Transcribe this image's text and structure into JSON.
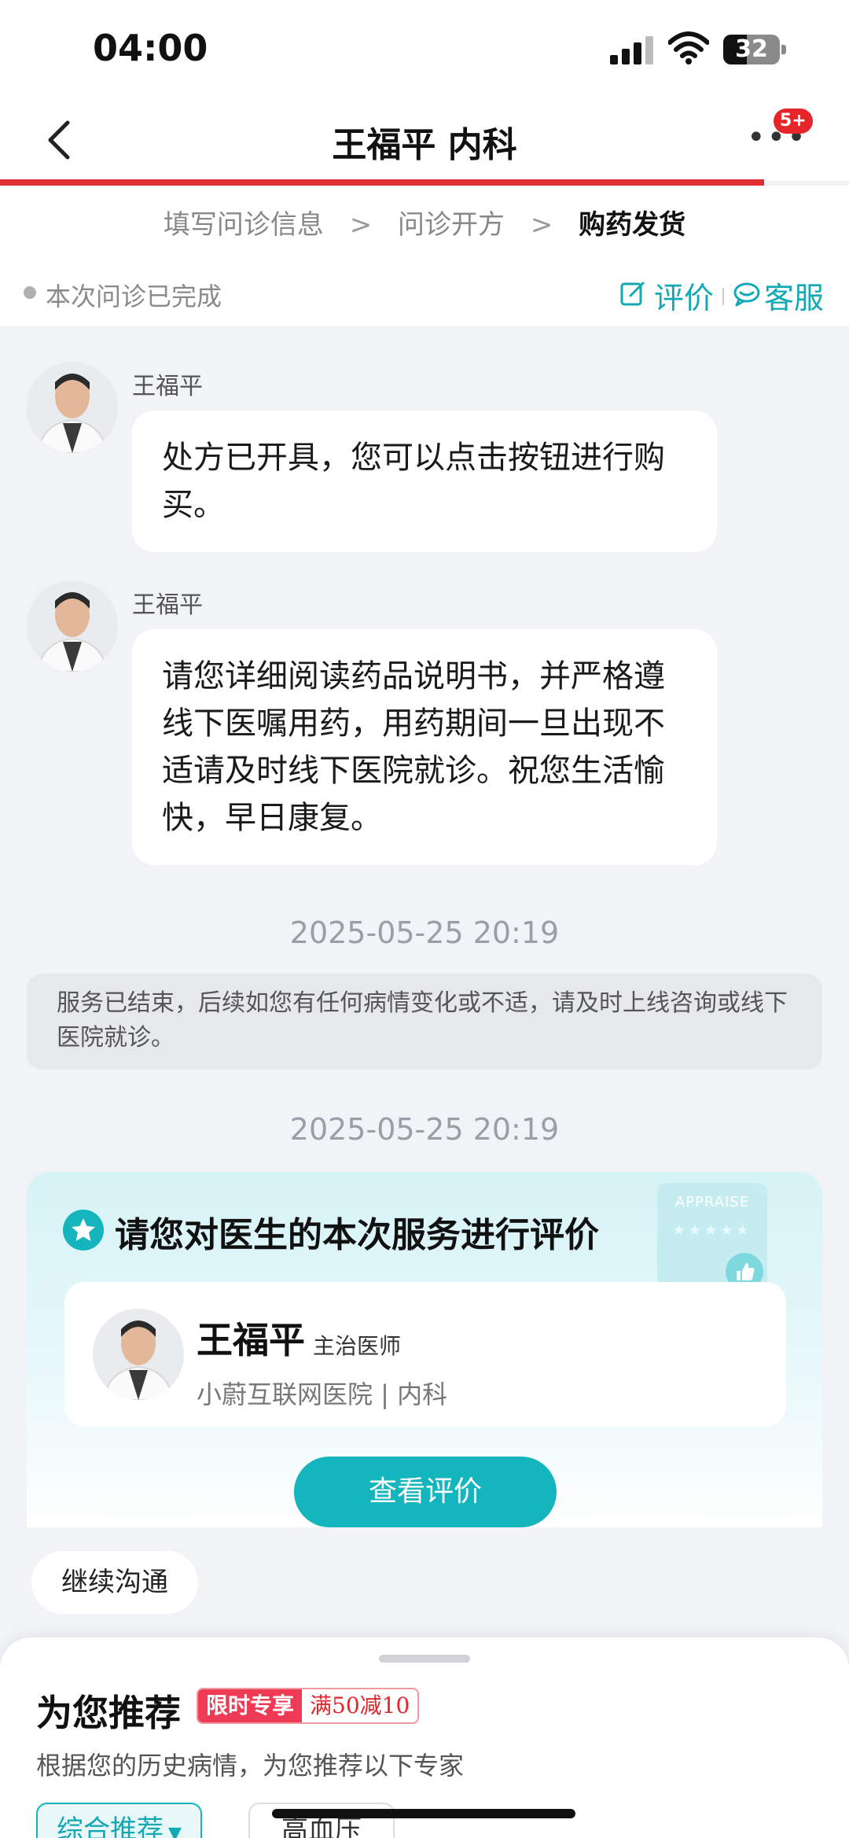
{
  "status_bar": {
    "time": "04:00",
    "battery": "32"
  },
  "nav": {
    "title": "王福平 内科",
    "badge": "5+"
  },
  "steps": [
    "填写问诊信息",
    "问诊开方",
    "购药发货"
  ],
  "step_separator": ">",
  "consult": {
    "status": "本次问诊已完成",
    "evaluate": "评价",
    "service": "客服"
  },
  "messages": [
    {
      "sender": "王福平",
      "text": "处方已开具，您可以点击按钮进行购买。"
    },
    {
      "sender": "王福平",
      "text": "请您详细阅读药品说明书，并严格遵线下医嘱用药，用药期间一旦出现不适请及时线下医院就诊。祝您生活愉快，早日康复。"
    }
  ],
  "timestamps": [
    "2025-05-25 20:19",
    "2025-05-25 20:19"
  ],
  "notice": "服务已结束，后续如您有任何病情变化或不适，请及时上线咨询或线下医院就诊。",
  "review": {
    "title": "请您对医生的本次服务进行评价",
    "decor_word": "APPRAISE",
    "doctor_name": "王福平",
    "doctor_title": "主治医师",
    "hospital": "小蔚互联网医院 | 内科",
    "button": "查看评价"
  },
  "continue_chip": "继续沟通",
  "recommend": {
    "title": "为您推荐",
    "promo_tag": "限时专享",
    "promo_deal": "满50减10",
    "subtitle": "根据您的历史病情，为您推荐以下专家",
    "filters": [
      "综合推荐",
      "高血压"
    ]
  },
  "colors": {
    "accent": "#13a9b4",
    "brand_red": "#e02f34",
    "button": "#14b5bd"
  }
}
